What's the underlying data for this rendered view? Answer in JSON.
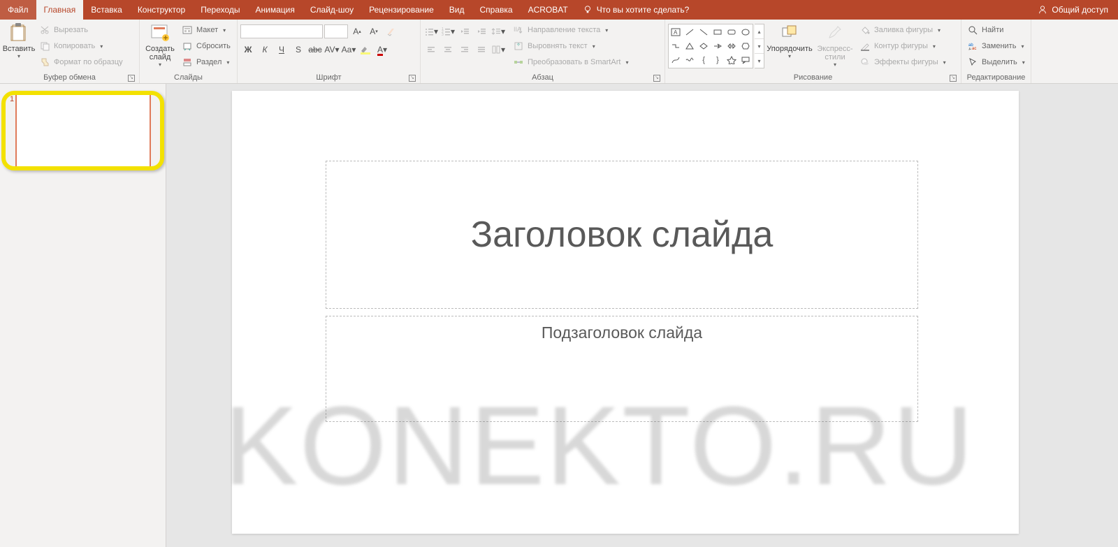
{
  "tabs": {
    "file": "Файл",
    "home": "Главная",
    "insert": "Вставка",
    "design": "Конструктор",
    "transitions": "Переходы",
    "animations": "Анимация",
    "slideshow": "Слайд-шоу",
    "review": "Рецензирование",
    "view": "Вид",
    "help": "Справка",
    "acrobat": "ACROBAT",
    "tellme": "Что вы хотите сделать?",
    "share": "Общий доступ"
  },
  "clipboard": {
    "group": "Буфер обмена",
    "paste": "Вставить",
    "cut": "Вырезать",
    "copy": "Копировать",
    "format_painter": "Формат по образцу"
  },
  "slides": {
    "group": "Слайды",
    "new_slide": "Создать слайд",
    "layout": "Макет",
    "reset": "Сбросить",
    "section": "Раздел"
  },
  "font": {
    "group": "Шрифт",
    "name_placeholder": "",
    "size_placeholder": ""
  },
  "paragraph": {
    "group": "Абзац",
    "text_direction": "Направление текста",
    "align_text": "Выровнять текст",
    "convert_smartart": "Преобразовать в SmartArt"
  },
  "drawing": {
    "group": "Рисование",
    "arrange": "Упорядочить",
    "quick_styles": "Экспресс-стили",
    "shape_fill": "Заливка фигуры",
    "shape_outline": "Контур фигуры",
    "shape_effects": "Эффекты фигуры"
  },
  "editing": {
    "group": "Редактирование",
    "find": "Найти",
    "replace": "Заменить",
    "select": "Выделить"
  },
  "thumbnail": {
    "number": "1"
  },
  "slide": {
    "title_placeholder": "Заголовок слайда",
    "subtitle_placeholder": "Подзаголовок слайда"
  },
  "watermark": "KONEKTO.RU",
  "colors": {
    "brand": "#b7472a",
    "highlight": "#f3e100"
  }
}
